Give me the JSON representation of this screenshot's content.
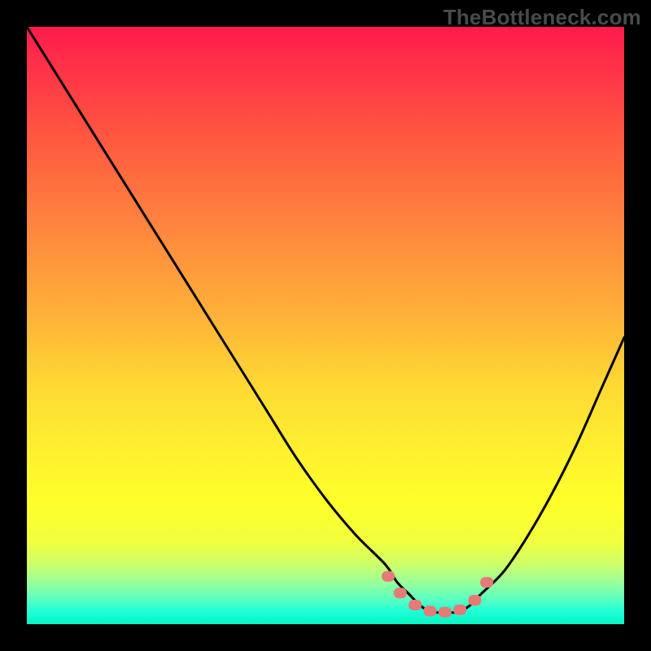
{
  "watermark": "TheBottleneck.com",
  "chart_data": {
    "type": "line",
    "title": "",
    "xlabel": "",
    "ylabel": "",
    "xlim": [
      0,
      100
    ],
    "ylim": [
      0,
      100
    ],
    "series": [
      {
        "name": "bottleneck-curve",
        "x": [
          0,
          5,
          10,
          15,
          20,
          25,
          30,
          35,
          40,
          45,
          50,
          55,
          60,
          62,
          64,
          66,
          68,
          70,
          72,
          74,
          76,
          80,
          84,
          88,
          92,
          96,
          100
        ],
        "y": [
          100,
          92,
          84,
          76,
          68,
          60,
          52,
          44,
          36,
          28,
          21,
          15,
          10,
          7,
          5,
          3,
          2,
          2,
          2,
          3,
          5,
          9,
          15,
          22,
          30,
          39,
          48
        ]
      }
    ],
    "highlight": {
      "name": "optimal-range",
      "points_x": [
        60.5,
        62.5,
        65.0,
        67.5,
        70.0,
        72.5,
        75.0,
        77.0
      ],
      "points_y": [
        8.0,
        5.2,
        3.2,
        2.2,
        2.0,
        2.4,
        4.0,
        7.0
      ]
    },
    "gradient_stops": [
      {
        "pos": 0,
        "color": "#ff1a4d"
      },
      {
        "pos": 18,
        "color": "#ff5640"
      },
      {
        "pos": 48,
        "color": "#ffb03a"
      },
      {
        "pos": 72,
        "color": "#fff22e"
      },
      {
        "pos": 90,
        "color": "#cdff6a"
      },
      {
        "pos": 100,
        "color": "#05f5c1"
      }
    ]
  }
}
